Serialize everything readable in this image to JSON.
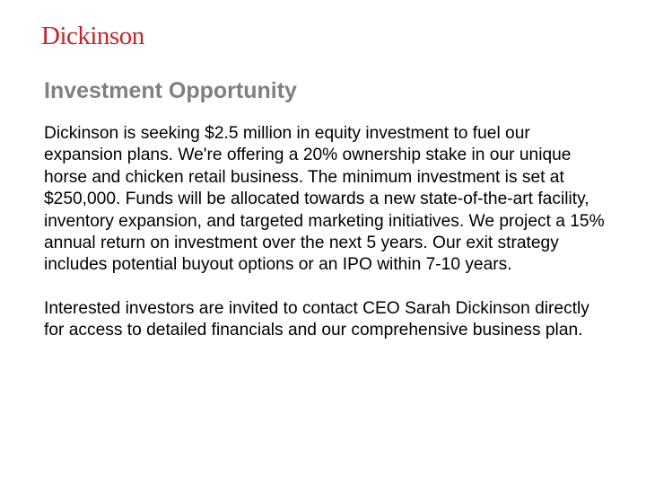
{
  "brand": {
    "logo_text": "Dickinson",
    "color": "#c1272d"
  },
  "slide": {
    "title": "Investment Opportunity",
    "title_color": "#808080",
    "paragraphs": [
      "Dickinson is seeking $2.5 million in equity investment to fuel our expansion plans. We're offering a 20% ownership stake in our unique horse and chicken retail business. The minimum investment is set at $250,000. Funds will be allocated towards a new state-of-the-art facility, inventory expansion, and targeted marketing initiatives. We project a 15% annual return on investment over the next 5 years. Our exit strategy includes potential buyout options or an IPO within 7-10 years.",
      "Interested investors are invited to contact CEO Sarah Dickinson directly for access to detailed financials and our comprehensive business plan."
    ]
  }
}
